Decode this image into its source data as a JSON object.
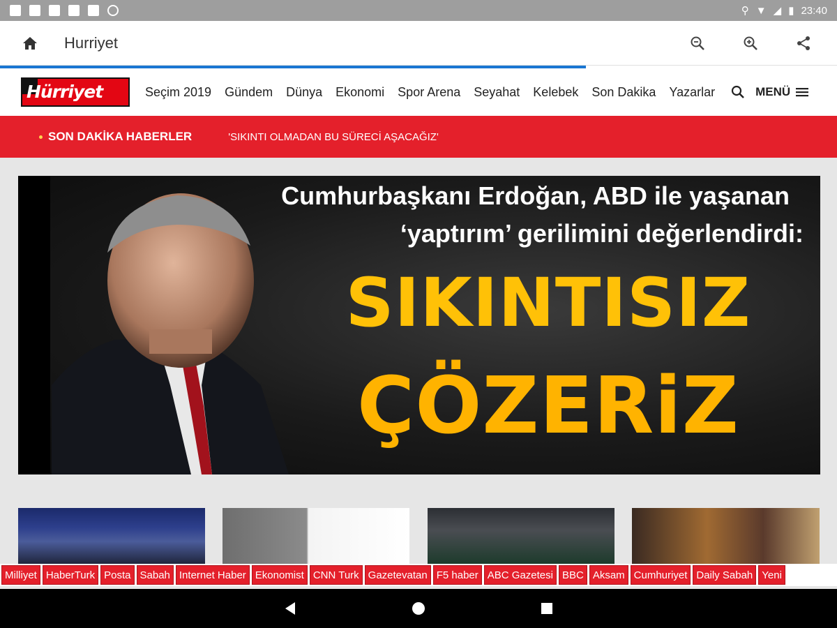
{
  "status_bar": {
    "time": "23:40",
    "icons": [
      "notification-icon",
      "notification-icon",
      "notification-icon",
      "text-icon",
      "sim-icon",
      "circle-icon"
    ],
    "right_icons": [
      "location-icon",
      "wifi-icon",
      "signal-icon",
      "battery-icon"
    ]
  },
  "toolbar": {
    "title": "Hurriyet",
    "actions": [
      "zoom-out-icon",
      "zoom-in-icon",
      "share-icon"
    ],
    "progress_fraction": 0.7
  },
  "site": {
    "logo_text": "Hürriyet",
    "nav": [
      "Seçim 2019",
      "Gündem",
      "Dünya",
      "Ekonomi",
      "Spor Arena",
      "Seyahat",
      "Kelebek",
      "Son Dakika",
      "Yazarlar"
    ],
    "menu_label": "MENÜ"
  },
  "breaking": {
    "label": "SON DAKİKA HABERLER",
    "headline": "'SIKINTI OLMADAN BU SÜRECİ AŞACAĞIZ'"
  },
  "hero": {
    "line1": "Cumhurbaşkanı Erdoğan, ABD ile yaşanan",
    "line2": "‘yaptırım’ gerilimini değerlendirdi:",
    "big1": "SIKINTISIZ",
    "big2": "ÇÖZERiZ"
  },
  "sources": [
    "Milliyet",
    "HaberTurk",
    "Posta",
    "Sabah",
    "Internet Haber",
    "Ekonomist",
    "CNN Turk",
    "Gazetevatan",
    "F5 haber",
    "ABC Gazetesi",
    "BBC",
    "Aksam",
    "Cumhuriyet",
    "Daily Sabah",
    "Yeni"
  ],
  "colors": {
    "accent_red": "#e4202b",
    "progress_blue": "#1976d2",
    "headline_yellow": "#ffc107"
  }
}
